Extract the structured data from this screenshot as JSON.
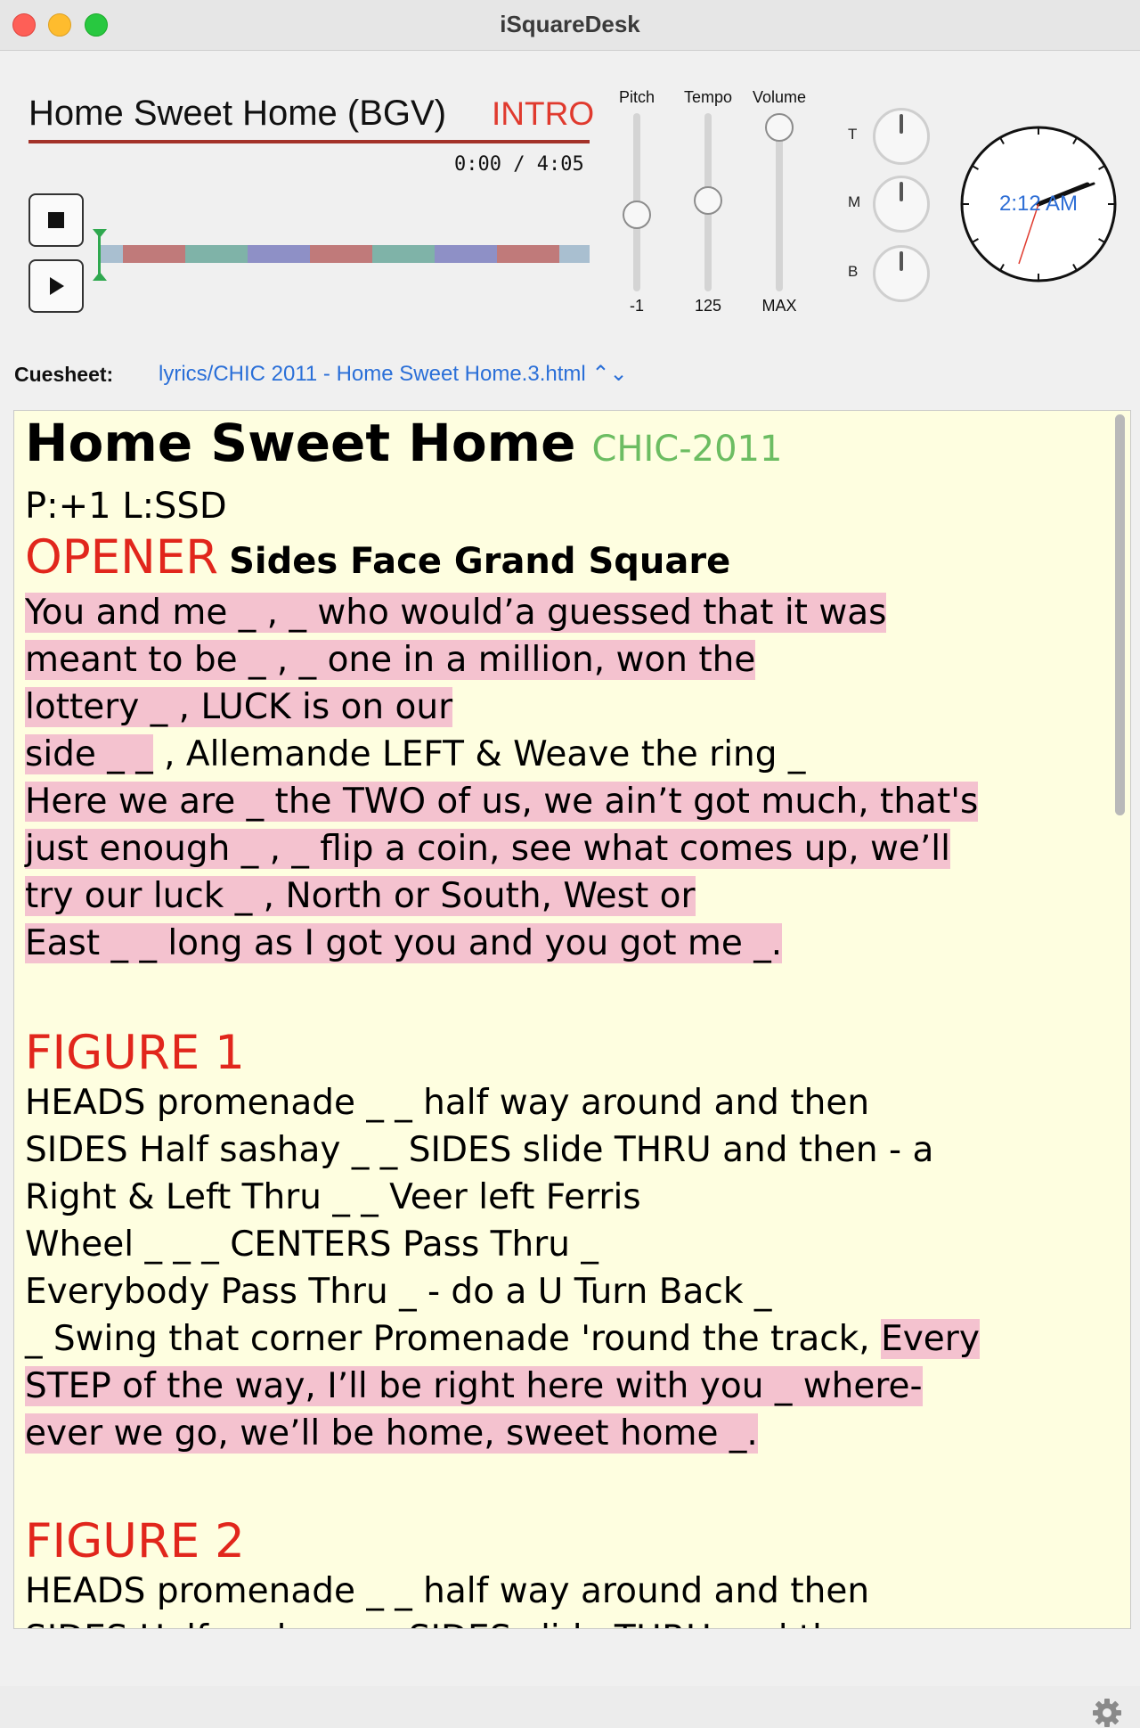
{
  "window": {
    "title": "iSquareDesk"
  },
  "player": {
    "song_title": "Home Sweet Home (BGV)",
    "section": "INTRO",
    "time": "0:00 / 4:05",
    "segment_colors": [
      "#c07a7a",
      "#7fb3a8",
      "#8e90c6"
    ],
    "progress": 0
  },
  "sliders": [
    {
      "label": "Pitch",
      "value": "-1"
    },
    {
      "label": "Tempo",
      "value": "125"
    },
    {
      "label": "Volume",
      "value": "MAX"
    }
  ],
  "eq": [
    {
      "label": "T"
    },
    {
      "label": "M"
    },
    {
      "label": "B"
    }
  ],
  "clock": {
    "time": "2:12 AM"
  },
  "cuesheet": {
    "label": "Cuesheet:",
    "file": "lyrics/CHIC 2011 - Home Sweet Home.3.html ⌃⌄"
  },
  "sheet": {
    "title": "Home Sweet Home",
    "tag": "CHIC-2011",
    "meta": "P:+1 L:SSD",
    "opener_label": "OPENER",
    "opener_sub": "Sides Face Grand Square",
    "opener_lines": [
      {
        "text": "You and me _ , _ who would’a guessed that it was",
        "hl": true
      },
      {
        "text": "meant to be _ , _ one in a million, won the",
        "hl": true
      },
      {
        "text": "lottery _ , LUCK is on our",
        "hl": true
      },
      {
        "text": "side _ _ , Allemande LEFT & Weave the ring _",
        "hl": false,
        "hl_prefix": "side _ _"
      },
      {
        "text": "Here we are _ the TWO of us, we ain’t got much, that's",
        "hl": true
      },
      {
        "text": "just enough _ , _ flip a coin, see what comes up, we’ll",
        "hl": true
      },
      {
        "text": "try our luck _ , North or South, West or",
        "hl": true
      },
      {
        "text": "East _ _ long as I got you and you got me _.",
        "hl": true
      }
    ],
    "figure1_label": "FIGURE 1",
    "figure1_lines": [
      "HEADS promenade _ _ half way around and then",
      "SIDES Half sashay _ _ SIDES slide THRU and then - a",
      "Right & Left Thru _ _ Veer left Ferris",
      "Wheel _ _ _ CENTERS Pass Thru _",
      "Everybody Pass Thru _ - do a U Turn Back _"
    ],
    "figure1_mixed": {
      "plain": "_ Swing that corner Promenade 'round the track, ",
      "hl": "Every"
    },
    "figure1_hl_lines": [
      "STEP of the way, I’ll be right here with you _ where-",
      "ever we go, we’ll be home, sweet home _."
    ],
    "figure2_label": "FIGURE 2",
    "figure2_lines": [
      "HEADS promenade _ _ half way around and then",
      "SIDES Half sashay _ _ SIDES slide THRU and then"
    ]
  }
}
